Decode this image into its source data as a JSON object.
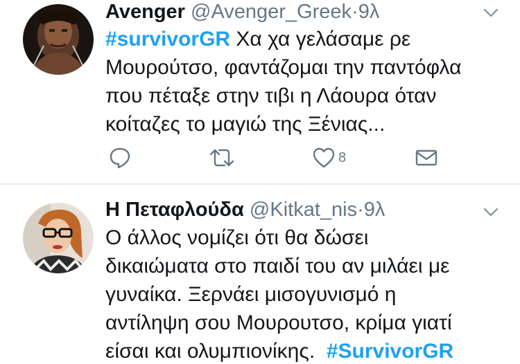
{
  "tweets": [
    {
      "author_name": "Avenger",
      "handle": "@Avenger_Greek",
      "separator": "·",
      "time": "9λ",
      "text_lines": [
        {
          "hashtag": "#survivorGR",
          "text": " Χα χα γελάσαμε ρε"
        },
        {
          "hashtag": "",
          "text": "Μουρούτσο, φαντάζομαι την παντόφλα"
        },
        {
          "hashtag": "",
          "text": "που πέταξε στην τιβι η Λάουρα όταν"
        },
        {
          "hashtag": "",
          "text": "κοίταζες το μαγιώ της Ξένιας..."
        }
      ],
      "like_count": "8",
      "icons": [
        "reply-icon",
        "retweet-icon",
        "heart-icon",
        "envelope-icon",
        "chevron-down-icon"
      ]
    },
    {
      "author_name": "Η Πεταφλούδα",
      "handle": "@Kitkat_nis",
      "separator": "·",
      "time": "9λ",
      "text_lines": [
        {
          "text": "Ο άλλος νομίζει ότι θα δώσει",
          "hashtag": ""
        },
        {
          "text": "δικαιώματα στο παιδί του αν μιλάει με",
          "hashtag": ""
        },
        {
          "text": "γυναίκα. Ξερνάει μισογυνισμό η",
          "hashtag": ""
        },
        {
          "text": "αντίληψη σου Μουρουτσο, κρίμα γιατί",
          "hashtag": ""
        },
        {
          "text": "είσαι και ολυμπιονίκης.  ",
          "hashtag": "#SurvivorGR"
        }
      ],
      "icons": [
        "chevron-down-icon"
      ]
    }
  ],
  "colors": {
    "hashtag": "#1da1f2",
    "secondary_text": "#657786",
    "divider": "#e6ecf0",
    "icon": "#657786"
  }
}
